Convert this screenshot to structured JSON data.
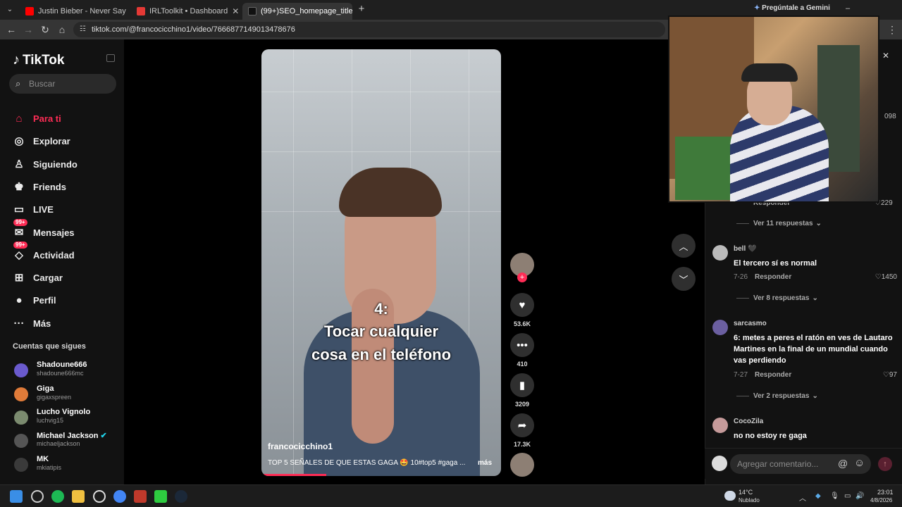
{
  "browser": {
    "tabs": [
      {
        "title": "Justin Bieber - Never Say Never",
        "color": "#ff0000"
      },
      {
        "title": "IRLToolkit • Dashboard",
        "color": "#e53935"
      },
      {
        "title": "(99+)SEO_homepage_title",
        "color": "#111111"
      }
    ],
    "url": "tiktok.com/@francocicchino1/video/7666877149013478676",
    "gemini_label": "Pregúntale a Gemini"
  },
  "sidebar": {
    "logo": "TikTok",
    "search_placeholder": "Buscar",
    "nav": [
      {
        "label": "Para ti",
        "icon": "home-icon",
        "glyph": "⌂"
      },
      {
        "label": "Explorar",
        "icon": "compass-icon",
        "glyph": "◎"
      },
      {
        "label": "Siguiendo",
        "icon": "following-icon",
        "glyph": "♙"
      },
      {
        "label": "Friends",
        "icon": "friends-icon",
        "glyph": "♚"
      },
      {
        "label": "LIVE",
        "icon": "live-icon",
        "glyph": "▭"
      },
      {
        "label": "Mensajes",
        "icon": "messages-icon",
        "glyph": "✉",
        "badge": "99+"
      },
      {
        "label": "Actividad",
        "icon": "activity-icon",
        "glyph": "◇",
        "badge": "99+"
      },
      {
        "label": "Cargar",
        "icon": "upload-icon",
        "glyph": "⊞"
      },
      {
        "label": "Perfil",
        "icon": "profile-icon",
        "glyph": "●"
      },
      {
        "label": "Más",
        "icon": "more-icon",
        "glyph": "···"
      }
    ],
    "following_title": "Cuentas que sigues",
    "accounts": [
      {
        "name": "Shadoune666",
        "handle": "shadoune666mc",
        "color": "#6a5acd"
      },
      {
        "name": "Giga",
        "handle": "gigaxspreen",
        "color": "#e07b39"
      },
      {
        "name": "Lucho Vignolo",
        "handle": "luchvig15",
        "color": "#7b8b6f"
      },
      {
        "name": "Michael Jackson",
        "handle": "michaeljackson",
        "color": "#555555",
        "verified": true
      },
      {
        "name": "MK",
        "handle": "mkiatipis",
        "color": "#3a3a3a"
      }
    ]
  },
  "video": {
    "caption_number": "4:",
    "caption_line1": "Tocar cualquier",
    "caption_line2": "cosa en el teléfono",
    "author": "francocicchino1",
    "description": "TOP 5 SEÑALES DE QUE ESTAS GAGA 🤩 10#top5 #gaga ...",
    "more_label": "más",
    "progress_fraction": 0.27
  },
  "actions": {
    "likes": "53.6K",
    "comments": "410",
    "saves": "3209",
    "shares": "17.3K"
  },
  "comments": {
    "top_partial": {
      "reply": "Responder",
      "likes": "229"
    },
    "replies_11": "Ver 11 respuestas",
    "items": [
      {
        "user": "bell 🖤",
        "text": "El tercero sí es normal",
        "date": "7-26",
        "reply": "Responder",
        "likes": "1450",
        "more": "Ver 8 respuestas",
        "color": "#bbb"
      },
      {
        "user": "sarcasmo",
        "text": "6: metes a peres el ratón en ves de Lautaro Martines en la final de un mundial cuando vas perdiendo",
        "date": "7-27",
        "reply": "Responder",
        "likes": "97",
        "more": "Ver 2 respuestas",
        "color": "#6b5fa0"
      },
      {
        "user": "CocoZila",
        "text": "no no estoy re gaga",
        "color": "#c59a9a"
      }
    ],
    "placeholder": "Agregar comentario...",
    "partial_count": "098"
  },
  "taskbar": {
    "weather_temp": "14°C",
    "weather_desc": "Nublado",
    "time": "23:01",
    "date": "4/8/2026"
  }
}
